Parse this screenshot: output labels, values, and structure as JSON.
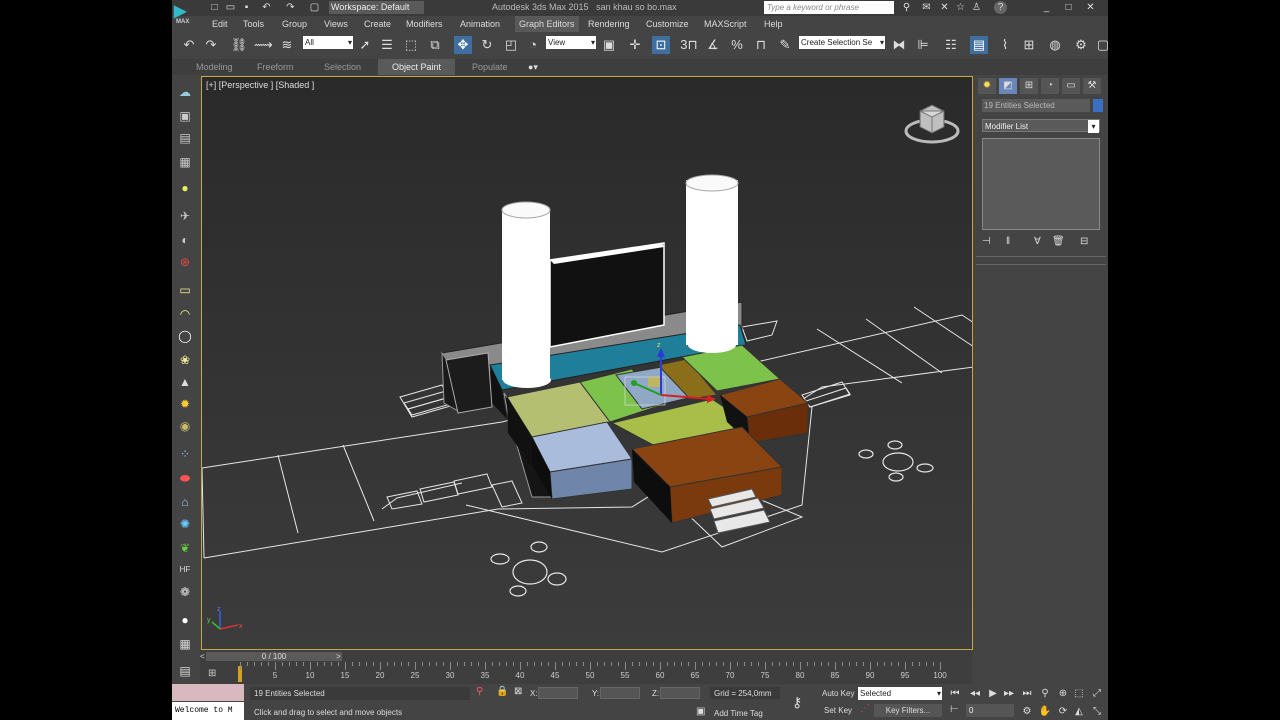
{
  "title_bar": {
    "workspace": "Workspace: Default",
    "app_title": "Autodesk 3ds Max  2015",
    "file_name": "san khau so bo.max",
    "search_placeholder": "Type a keyword or phrase",
    "logo_text": "MAX"
  },
  "menu": [
    "Edit",
    "Tools",
    "Group",
    "Views",
    "Create",
    "Modifiers",
    "Animation",
    "Graph Editors",
    "Rendering",
    "Customize",
    "MAXScript",
    "Help"
  ],
  "menu_active": "Graph Editors",
  "toolbar": {
    "selection_filter": "All",
    "ref_coord": "View",
    "named_selection": "Create Selection Se",
    "angle_snap_label": "3"
  },
  "ribbon": {
    "tabs": [
      "Modeling",
      "Freeform",
      "Selection",
      "Object Paint",
      "Populate"
    ],
    "active": "Object Paint"
  },
  "viewport": {
    "label": "[+] [Perspective ] [Shaded ]",
    "axis_labels": {
      "x": "x",
      "y": "y",
      "z": "z"
    }
  },
  "command_panel": {
    "selection_name": "19 Entities Selected",
    "modifier_list": "Modifier List",
    "selection_color": "#3a6fc4"
  },
  "timeline": {
    "slider_label": "0 / 100",
    "ticks": [
      "0",
      "5",
      "10",
      "15",
      "20",
      "25",
      "30",
      "35",
      "40",
      "45",
      "50",
      "55",
      "60",
      "65",
      "70",
      "75",
      "80",
      "85",
      "90",
      "95",
      "100"
    ]
  },
  "status": {
    "maxscript_listener": "Welcome to M",
    "selection_info": "19 Entities Selected",
    "prompt": "Click and drag to select and move objects",
    "x_label": "X:",
    "y_label": "Y:",
    "z_label": "Z:",
    "grid": "Grid = 254,0mm",
    "add_time_tag": "Add Time Tag",
    "auto_key": "Auto Key",
    "set_key": "Set Key",
    "key_mode": "Selected",
    "key_filters": "Key Filters...",
    "current_frame": "0"
  },
  "colors": {
    "viewport_border": "#c8a640",
    "teal_platform": "#1f7f9a",
    "green_block": "#7dc24a",
    "olive_block": "#b5bf72",
    "blue_block": "#7f95bd",
    "brown_block": "#8a4412",
    "gold_block": "#8a6e1a"
  }
}
